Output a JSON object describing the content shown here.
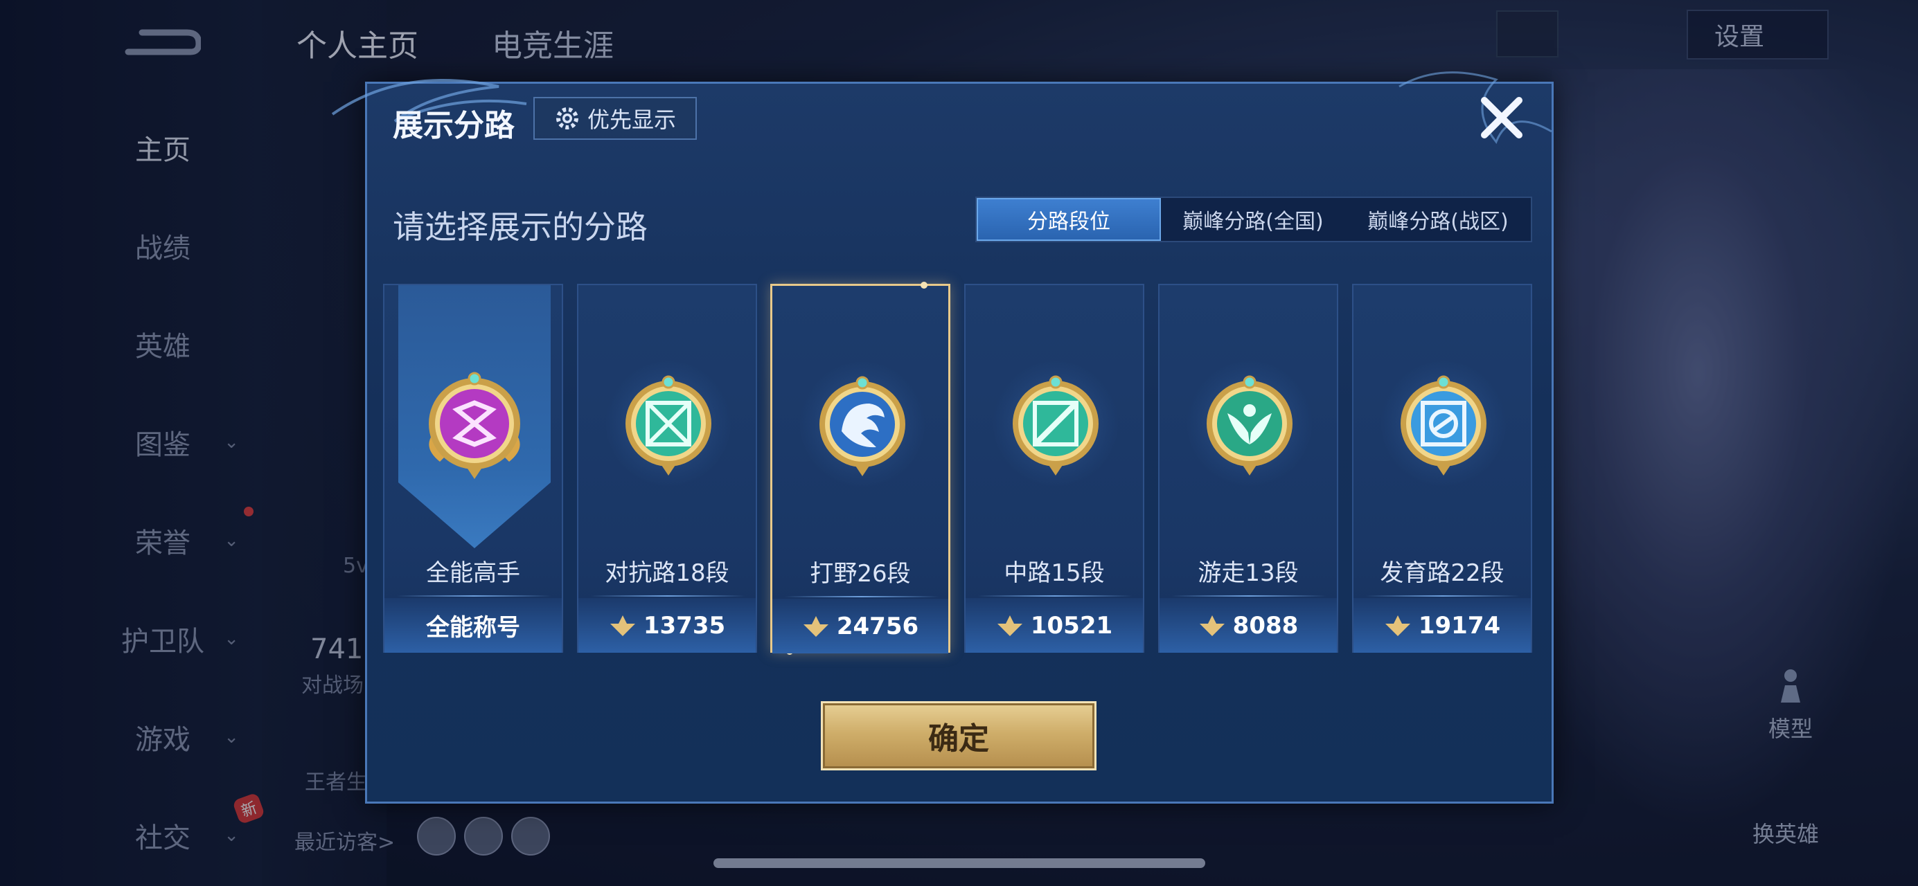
{
  "background": {
    "top_tabs": [
      "个人主页",
      "电竞生涯"
    ],
    "settings_label": "设置",
    "nav": [
      "主页",
      "战绩",
      "英雄",
      "图鉴",
      "荣誉",
      "护卫队",
      "游戏",
      "社交"
    ],
    "new_badge": "新",
    "partial_texts": [
      "5v",
      "741",
      "对战场",
      "王者生"
    ],
    "recent_visitors_label": "最近访客>",
    "model_label": "模型",
    "swap_hero_label": "换英雄"
  },
  "modal": {
    "title": "展示分路",
    "priority_label": "优先显示",
    "subtitle": "请选择展示的分路",
    "tabs": [
      {
        "label": "分路段位",
        "active": true
      },
      {
        "label": "巅峰分路(全国)",
        "active": false
      },
      {
        "label": "巅峰分路(战区)",
        "active": false
      }
    ],
    "cards": [
      {
        "name": "全能高手",
        "bottom": "全能称号",
        "has_points_icon": false,
        "emblem": "all-round-emblem-icon",
        "color": "#b43ac2"
      },
      {
        "name": "对抗路18段",
        "bottom": "13735",
        "has_points_icon": true,
        "emblem": "clash-lane-emblem-icon",
        "color": "#2fb89a"
      },
      {
        "name": "打野26段",
        "bottom": "24756",
        "has_points_icon": true,
        "emblem": "jungle-emblem-icon",
        "color": "#2d6fc4",
        "selected": true
      },
      {
        "name": "中路15段",
        "bottom": "10521",
        "has_points_icon": true,
        "emblem": "mid-lane-emblem-icon",
        "color": "#2fb89a"
      },
      {
        "name": "游走13段",
        "bottom": "8088",
        "has_points_icon": true,
        "emblem": "roam-emblem-icon",
        "color": "#2aa886"
      },
      {
        "name": "发育路22段",
        "bottom": "19174",
        "has_points_icon": true,
        "emblem": "farm-lane-emblem-icon",
        "color": "#3a9be0"
      }
    ],
    "confirm_label": "确定"
  },
  "colors": {
    "accent_gold": "#e8c98a",
    "tab_active": "#3e7fd0",
    "modal_bg": "#1d3a68"
  }
}
